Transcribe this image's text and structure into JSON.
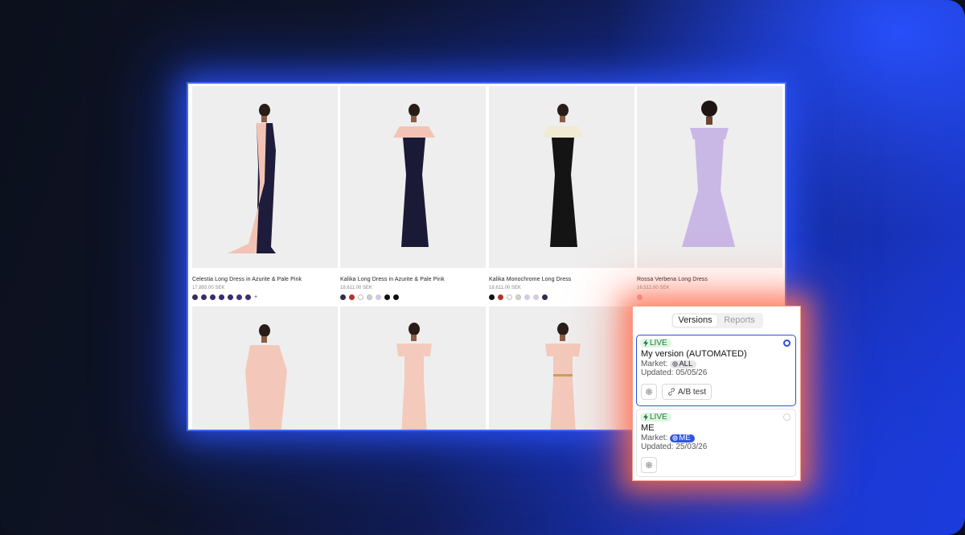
{
  "products": [
    {
      "name": "Celestia Long Dress in Azurite & Pale Pink",
      "price": "17,893.00 SEK",
      "swatches": [
        "#3b2f59",
        "#3c2d63",
        "#3d2a6b",
        "#3a2a72",
        "#3b2b6e",
        "#40307a",
        "#3d2e6a"
      ],
      "more": "+",
      "dress_a": "#f2c3b5",
      "dress_b": "#1d1c3a"
    },
    {
      "name": "Kalika Long Dress in Azurite & Pale Pink",
      "price": "18,611.00 SEK",
      "swatches": [
        "#2f2f48",
        "#b3332c",
        "#ffffff",
        "#cfcfd8",
        "#d6c6e6",
        "#101010",
        "#0d0d0d"
      ],
      "more": "",
      "dress_a": "#f3c4b6",
      "dress_b": "#1a1a36"
    },
    {
      "name": "Kalika Monochrome Long Dress",
      "price": "18,611.00 SEK",
      "swatches": [
        "#111111",
        "#b3332c",
        "#ffffff",
        "#d9d3c4",
        "#d8c8e8",
        "#d7c7e7",
        "#2f2f48"
      ],
      "more": "",
      "dress_a": "#f1ead4",
      "dress_b": "#141414"
    },
    {
      "name": "Rossa Verbena Long Dress",
      "price": "16,512.00 SEK",
      "swatches": [
        "#e6a9b3"
      ],
      "more": "",
      "dress_a": "#c9b7e6",
      "dress_b": "#c9b7e6"
    },
    {
      "name": "",
      "price": "",
      "swatches": [],
      "more": "",
      "dress_a": "#f3c8bb",
      "dress_b": "#f3c8bb"
    },
    {
      "name": "",
      "price": "",
      "swatches": [],
      "more": "",
      "dress_a": "#f4cabd",
      "dress_b": "#f4cabd"
    },
    {
      "name": "",
      "price": "",
      "swatches": [],
      "more": "",
      "dress_a": "#f3c9bc",
      "dress_b": "#f3c9bc"
    }
  ],
  "panel": {
    "tabs": [
      "Versions",
      "Reports"
    ],
    "active_tab": "Versions",
    "versions": [
      {
        "status": "LIVE",
        "title": "My version (AUTOMATED)",
        "market_label": "Market:",
        "market": "ALL",
        "updated": "Updated: 05/05/26",
        "selected": true,
        "ab_test_label": "A/B test"
      },
      {
        "status": "LIVE",
        "title": "ME",
        "market_label": "Market:",
        "market": "ME",
        "updated": "Updated: 25/03/26",
        "selected": false
      }
    ]
  },
  "icons": [
    "bolt-icon",
    "globe-icon",
    "gear-icon",
    "link-icon"
  ],
  "colors": {
    "accent": "#2f4ed8",
    "live_bg": "#dff6e4",
    "live_fg": "#237a39",
    "market_me": "#2f56e0"
  }
}
